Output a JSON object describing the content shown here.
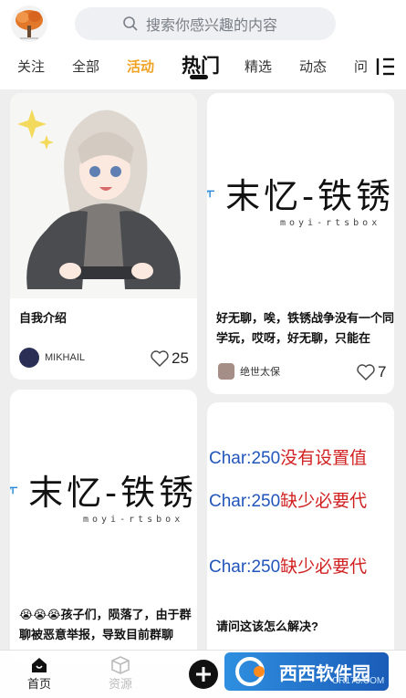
{
  "header": {
    "search_placeholder": "搜索你感兴趣的内容"
  },
  "tabs": [
    {
      "label": "关注"
    },
    {
      "label": "全部"
    },
    {
      "label": "活动"
    },
    {
      "label": "热门"
    },
    {
      "label": "精选"
    },
    {
      "label": "动态"
    },
    {
      "label": "问"
    }
  ],
  "feed": [
    {
      "title": "自我介绍",
      "user": "MIKHAIL",
      "likes": "25"
    },
    {
      "image_text": "末忆-铁锈",
      "image_sub": "moyi-rtsbox",
      "title": "好无聊，唉，铁锈战争没有一个同学玩，哎呀，好无聊，只能在",
      "user": "绝世太保",
      "likes": "7"
    },
    {
      "image_text": "末忆-铁锈",
      "image_sub": "moyi-rtsbox",
      "title": "😭😭😭孩子们，陨落了，由于群聊被恶意举报，导致目前群聊"
    },
    {
      "lines": [
        {
          "a": "Char:250",
          "b": "没有设置值"
        },
        {
          "a": "Char:250",
          "b": "缺少必要代"
        },
        {
          "a": "Char:250",
          "b": "缺少必要代"
        }
      ],
      "title": "请问这该怎么解决?"
    }
  ],
  "bottom_nav": [
    {
      "label": "首页"
    },
    {
      "label": "资源"
    }
  ],
  "watermark": {
    "text": "西西软件园",
    "sub": "CR173.COM"
  },
  "colors": {
    "accent": "#f0a324",
    "active": "#111111"
  }
}
